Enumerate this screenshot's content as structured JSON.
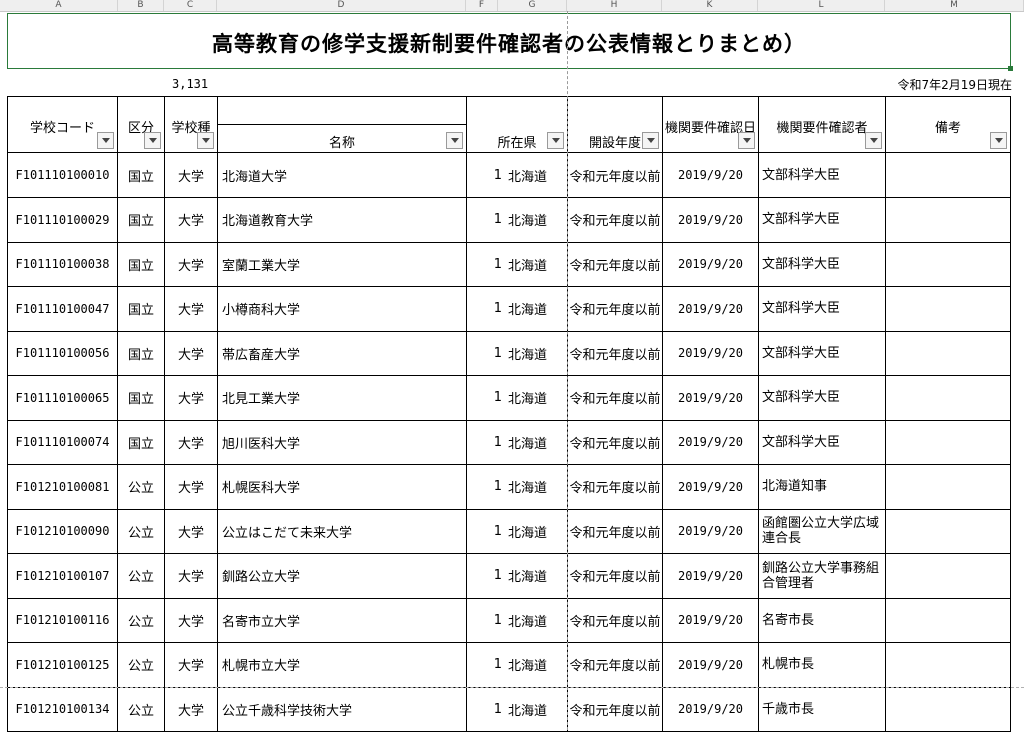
{
  "column_letters": [
    "A",
    "B",
    "C",
    "D",
    "F",
    "G",
    "H",
    "K",
    "L",
    "M"
  ],
  "title": "高等教育の修学支援新制要件確認者の公表情報とりまとめ）",
  "count": "3,131",
  "as_of": "令和7年2月19日現在",
  "headers": {
    "code": "学校コード",
    "kubun": "区分",
    "shubetsu": "学校種",
    "name": "名称",
    "pref": "所在県",
    "year": "開設年度",
    "confirm_date": "機関要件確認日",
    "confirmer": "機関要件確認者",
    "bikou": "備考"
  },
  "rows": [
    {
      "code": "F101110100010",
      "kubun": "国立",
      "shubetsu": "大学",
      "name": "北海道大学",
      "pref_num": "1",
      "pref": "北海道",
      "year": "令和元年度以前",
      "date": "2019/9/20",
      "confirmer": "文部科学大臣",
      "bikou": ""
    },
    {
      "code": "F101110100029",
      "kubun": "国立",
      "shubetsu": "大学",
      "name": "北海道教育大学",
      "pref_num": "1",
      "pref": "北海道",
      "year": "令和元年度以前",
      "date": "2019/9/20",
      "confirmer": "文部科学大臣",
      "bikou": ""
    },
    {
      "code": "F101110100038",
      "kubun": "国立",
      "shubetsu": "大学",
      "name": "室蘭工業大学",
      "pref_num": "1",
      "pref": "北海道",
      "year": "令和元年度以前",
      "date": "2019/9/20",
      "confirmer": "文部科学大臣",
      "bikou": ""
    },
    {
      "code": "F101110100047",
      "kubun": "国立",
      "shubetsu": "大学",
      "name": "小樽商科大学",
      "pref_num": "1",
      "pref": "北海道",
      "year": "令和元年度以前",
      "date": "2019/9/20",
      "confirmer": "文部科学大臣",
      "bikou": ""
    },
    {
      "code": "F101110100056",
      "kubun": "国立",
      "shubetsu": "大学",
      "name": "帯広畜産大学",
      "pref_num": "1",
      "pref": "北海道",
      "year": "令和元年度以前",
      "date": "2019/9/20",
      "confirmer": "文部科学大臣",
      "bikou": ""
    },
    {
      "code": "F101110100065",
      "kubun": "国立",
      "shubetsu": "大学",
      "name": "北見工業大学",
      "pref_num": "1",
      "pref": "北海道",
      "year": "令和元年度以前",
      "date": "2019/9/20",
      "confirmer": "文部科学大臣",
      "bikou": ""
    },
    {
      "code": "F101110100074",
      "kubun": "国立",
      "shubetsu": "大学",
      "name": "旭川医科大学",
      "pref_num": "1",
      "pref": "北海道",
      "year": "令和元年度以前",
      "date": "2019/9/20",
      "confirmer": "文部科学大臣",
      "bikou": ""
    },
    {
      "code": "F101210100081",
      "kubun": "公立",
      "shubetsu": "大学",
      "name": "札幌医科大学",
      "pref_num": "1",
      "pref": "北海道",
      "year": "令和元年度以前",
      "date": "2019/9/20",
      "confirmer": "北海道知事",
      "bikou": ""
    },
    {
      "code": "F101210100090",
      "kubun": "公立",
      "shubetsu": "大学",
      "name": "公立はこだて未来大学",
      "pref_num": "1",
      "pref": "北海道",
      "year": "令和元年度以前",
      "date": "2019/9/20",
      "confirmer": "函館圏公立大学広域連合長",
      "bikou": ""
    },
    {
      "code": "F101210100107",
      "kubun": "公立",
      "shubetsu": "大学",
      "name": "釧路公立大学",
      "pref_num": "1",
      "pref": "北海道",
      "year": "令和元年度以前",
      "date": "2019/9/20",
      "confirmer": "釧路公立大学事務組合管理者",
      "bikou": ""
    },
    {
      "code": "F101210100116",
      "kubun": "公立",
      "shubetsu": "大学",
      "name": "名寄市立大学",
      "pref_num": "1",
      "pref": "北海道",
      "year": "令和元年度以前",
      "date": "2019/9/20",
      "confirmer": "名寄市長",
      "bikou": ""
    },
    {
      "code": "F101210100125",
      "kubun": "公立",
      "shubetsu": "大学",
      "name": "札幌市立大学",
      "pref_num": "1",
      "pref": "北海道",
      "year": "令和元年度以前",
      "date": "2019/9/20",
      "confirmer": "札幌市長",
      "bikou": ""
    },
    {
      "code": "F101210100134",
      "kubun": "公立",
      "shubetsu": "大学",
      "name": "公立千歳科学技術大学",
      "pref_num": "1",
      "pref": "北海道",
      "year": "令和元年度以前",
      "date": "2019/9/20",
      "confirmer": "千歳市長",
      "bikou": ""
    }
  ]
}
